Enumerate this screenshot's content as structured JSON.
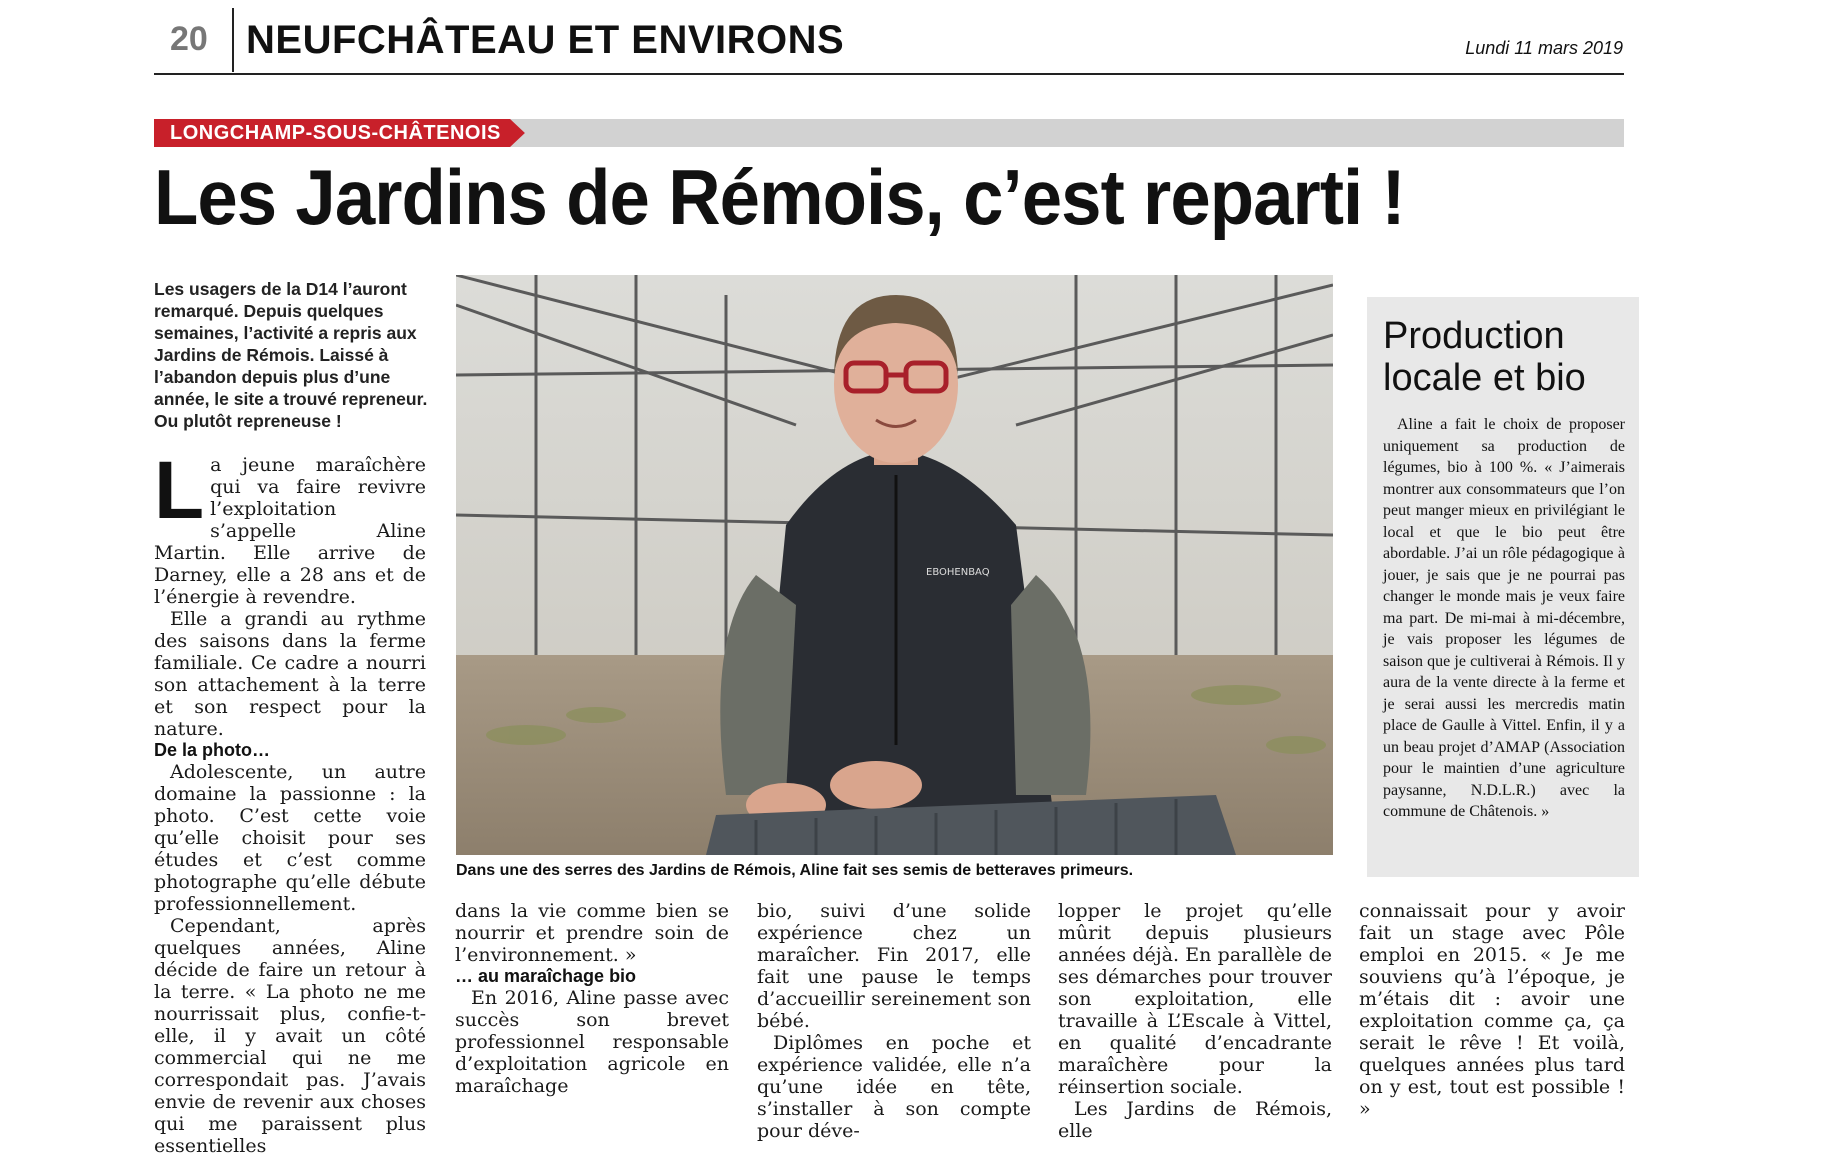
{
  "header": {
    "page_number": "20",
    "section": "NEUFCHÂTEAU ET ENVIRONS",
    "date": "Lundi 11 mars 2019"
  },
  "article": {
    "kicker": "LONGCHAMP-SOUS-CHÂTENOIS",
    "headline": "Les Jardins de Rémois, c’est reparti !",
    "chapo": "Les usagers de la D14 l’auront remarqué. Depuis quelques semaines, l’activité a repris aux Jardins de Rémois. Laissé à l’abandon depuis plus d’une année, le site a trouvé repreneur. Ou plutôt repreneuse !",
    "col1": {
      "dropcap": "L",
      "p1": "a jeune maraîchère qui va faire revivre l’exploitation s’appelle Aline Martin. Elle arrive de Darney, elle a 28 ans et de l’énergie à revendre.",
      "p2": "Elle a grandi au rythme des saisons dans la ferme familiale. Ce cadre a nourri son attachement à la terre et son respect pour la nature.",
      "subhead1": "De la photo…",
      "p3": "Adolescente, un autre domaine la passionne : la photo. C’est cette voie qu’elle choisit pour ses études et c’est comme photographe qu’elle débute professionnellement.",
      "p4": "Cependant, après quelques années, Aline décide de faire un retour à la terre. « La photo ne me nourrissait plus, confie-t-elle, il y avait un côté commercial qui ne me correspondait pas. J’avais envie de revenir aux choses qui me paraissent plus essentielles"
    },
    "col2": {
      "p1": "dans la vie comme bien se nourrir et prendre soin de l’environnement. »",
      "subhead2": "… au maraîchage bio",
      "p2": "En 2016, Aline passe avec succès son brevet professionnel responsable d’exploitation agricole en maraîchage"
    },
    "col3": {
      "p1": "bio, suivi d’une solide expérience chez un maraîcher. Fin 2017, elle fait une pause le temps d’accueillir sereinement son bébé.",
      "p2": "Diplômes en poche et expérience validée, elle n’a qu’une idée en tête, s’installer à son compte pour déve-"
    },
    "col4": {
      "p1": "lopper le projet qu’elle mûrit depuis plusieurs années déjà. En parallèle de ses démarches pour trouver son exploitation, elle travaille à L’Escale à Vittel, en qualité d’encadrante maraîchère pour la réinsertion sociale.",
      "p2": "Les Jardins de Rémois, elle"
    },
    "col5": {
      "p1": "connaissait pour y avoir fait un stage avec Pôle emploi en 2015. « Je me souviens qu’à l’époque, je m’étais dit : avoir une exploitation comme ça, ça serait le rêve ! Et voilà, quelques années plus tard on y est, tout est possible ! »"
    },
    "photo_caption": "Dans une des serres des Jardins de Rémois, Aline fait ses semis de betteraves primeurs.",
    "jacket_brand": "EBOHENBAQ"
  },
  "sidebar": {
    "title": "Production locale et bio",
    "text": "Aline a fait le choix de proposer uniquement sa production de légumes, bio à 100 %. « J’aimerais montrer aux consommateurs que l’on peut manger mieux en privilégiant le local et que le bio peut être abordable. J’ai un rôle pédagogique à jouer, je sais que je ne pourrai pas changer le monde mais je veux faire ma part. De mi-mai à mi-décembre, je vais proposer les légumes de saison que je cultiverai à Rémois. Il y aura de la vente directe à la ferme et je serai aussi les mercredis matin place de Gaulle à Vittel. Enfin, il y a un beau projet d’AMAP (Association pour le maintien d’une agriculture paysanne, N.D.L.R.) avec la commune de Châtenois. »"
  }
}
